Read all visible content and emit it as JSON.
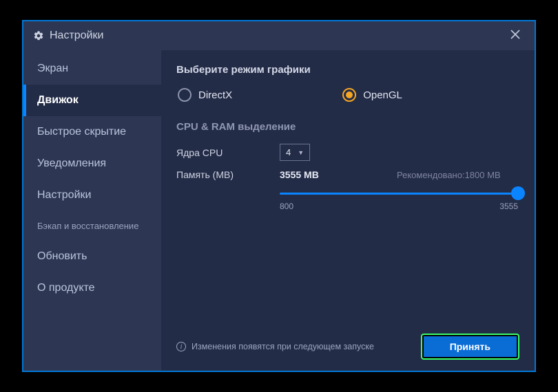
{
  "window": {
    "title": "Настройки"
  },
  "sidebar": {
    "items": [
      {
        "label": "Экран",
        "selected": false
      },
      {
        "label": "Движок",
        "selected": true
      },
      {
        "label": "Быстрое скрытие",
        "selected": false
      },
      {
        "label": "Уведомления",
        "selected": false
      },
      {
        "label": "Настройки",
        "selected": false
      },
      {
        "label": "Бэкап и восстановление",
        "selected": false,
        "small": true
      },
      {
        "label": "Обновить",
        "selected": false
      },
      {
        "label": "О продукте",
        "selected": false
      }
    ]
  },
  "content": {
    "graphics_mode_title": "Выберите режим графики",
    "graphics_options": {
      "directx": "DirectX",
      "opengl": "OpenGL",
      "selected": "opengl"
    },
    "alloc_title": "CPU & RAM выделение",
    "cpu_cores_label": "Ядра CPU",
    "cpu_cores_value": "4",
    "memory_label": "Память (MB)",
    "memory_value": "3555 MB",
    "recommended_label": "Рекомендовано:1800 MB",
    "slider_min": "800",
    "slider_max": "3555"
  },
  "footer": {
    "info_text": "Изменения появятся при следующем запуске",
    "accept_label": "Принять"
  }
}
